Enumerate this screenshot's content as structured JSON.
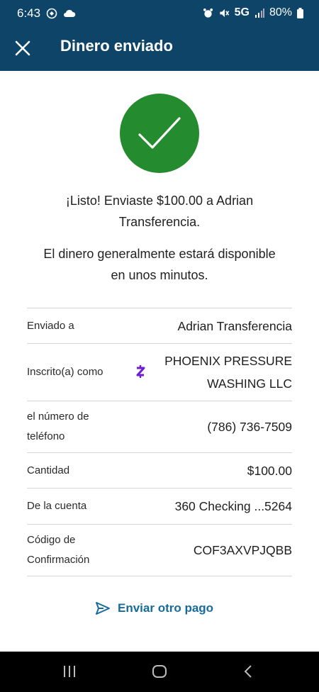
{
  "status_bar": {
    "time": "6:43",
    "network": "5G",
    "battery": "80%"
  },
  "header": {
    "title": "Dinero enviado"
  },
  "confirmation": {
    "message_line1": "¡Listo! Enviaste $100.00 a Adrian",
    "message_line2": "Transferencia.",
    "availability_line1": "El dinero generalmente estará disponible",
    "availability_line2": "en unos minutos."
  },
  "details": {
    "sent_to_label": "Enviado a",
    "sent_to_value": "Adrian Transferencia",
    "enrolled_label": "Inscrito(a) como",
    "enrolled_value_line1": "PHOENIX PRESSURE",
    "enrolled_value_line2": "WASHING LLC",
    "phone_label_line1": "el número de",
    "phone_label_line2": "teléfono",
    "phone_value": "(786) 736-7509",
    "amount_label": "Cantidad",
    "amount_value": "$100.00",
    "account_label": "De la cuenta",
    "account_value": "360 Checking ...5264",
    "code_label_line1": "Código de",
    "code_label_line2": "Confirmación",
    "code_value": "COF3AXVPJQBB"
  },
  "actions": {
    "send_another": "Enviar otro pago"
  },
  "colors": {
    "header_bg": "#0d4468",
    "success_green": "#248b2e",
    "link_blue": "#176b9c",
    "zelle_purple": "#6d1ed4"
  },
  "icons": {
    "close": "close-icon",
    "check": "checkmark-icon",
    "zelle": "zelle-icon",
    "send": "send-icon"
  }
}
